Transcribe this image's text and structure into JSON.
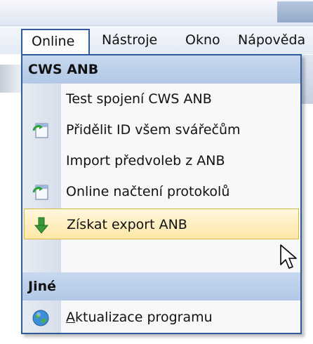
{
  "menubar": {
    "items": [
      {
        "label": "Online",
        "active": true
      },
      {
        "label": "Nástroje"
      },
      {
        "label": "Okno"
      },
      {
        "label": "Nápověda"
      }
    ]
  },
  "dropdown": {
    "sections": [
      {
        "header": "CWS ANB",
        "items": [
          {
            "label": "Test spojení CWS ANB",
            "icon": null
          },
          {
            "label": "Přidělit ID všem svářečům",
            "icon": "refresh-document-icon"
          },
          {
            "label": "Import předvoleb z ANB",
            "icon": null
          },
          {
            "label": "Online načtení protokolů",
            "icon": "refresh-document-icon"
          },
          {
            "label": "Získat export ANB",
            "icon": "download-arrow-icon",
            "highlighted": true
          }
        ]
      },
      {
        "header": "Jiné",
        "items": [
          {
            "label_accel": "A",
            "label_rest": "ktualizace programu",
            "icon": "globe-icon"
          }
        ]
      }
    ]
  },
  "colors": {
    "menu_border": "#2e5a9a",
    "section_header": "#b8cce8",
    "highlight": "#ffe7a6"
  }
}
